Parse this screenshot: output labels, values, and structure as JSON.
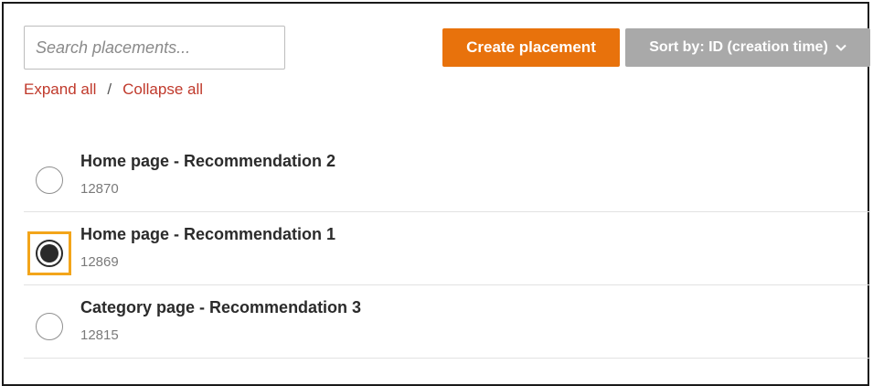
{
  "search": {
    "placeholder": "Search placements...",
    "value": ""
  },
  "links": {
    "expand_all": "Expand all",
    "separator": "/",
    "collapse_all": "Collapse all"
  },
  "toolbar": {
    "create_label": "Create placement",
    "sort_label": "Sort by: ID (creation time)"
  },
  "colors": {
    "create_button": "#e8720c",
    "sort_button": "#a9a9a9",
    "link": "#c0392b",
    "focus_ring": "#f3a51a"
  },
  "placements": [
    {
      "name": "Home page - Recommendation 2",
      "id": "12870",
      "selected": false
    },
    {
      "name": "Home page - Recommendation 1",
      "id": "12869",
      "selected": true
    },
    {
      "name": "Category page - Recommendation 3",
      "id": "12815",
      "selected": false
    }
  ]
}
